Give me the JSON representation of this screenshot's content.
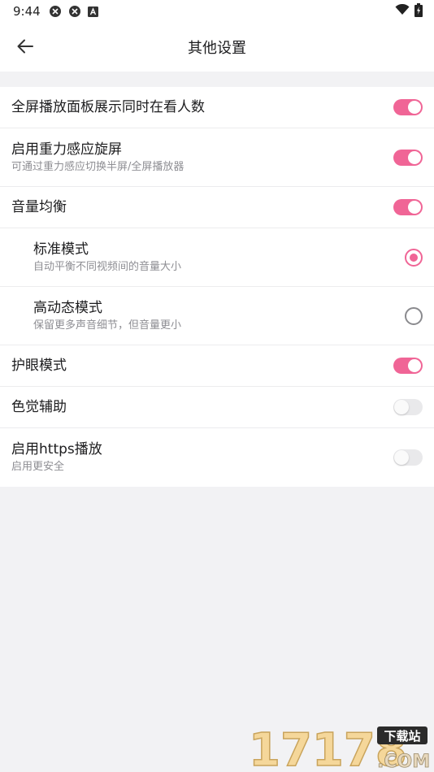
{
  "status_bar": {
    "time": "9:44",
    "icons_left": [
      "sync-icon",
      "sync-icon",
      "a-badge-icon"
    ],
    "icons_right": [
      "wifi-icon",
      "battery-charging-icon"
    ]
  },
  "app_bar": {
    "back_icon": "arrow-left-icon",
    "title": "其他设置"
  },
  "settings": [
    {
      "id": "fullscreen-watch-count",
      "label": "全屏播放面板展示同时在看人数",
      "desc": "",
      "control": "switch",
      "on": true
    },
    {
      "id": "gravity-rotate",
      "label": "启用重力感应旋屏",
      "desc": "可通过重力感应切换半屏/全屏播放器",
      "control": "switch",
      "on": true
    },
    {
      "id": "volume-balance",
      "label": "音量均衡",
      "desc": "",
      "control": "switch",
      "on": true
    },
    {
      "id": "standard-mode",
      "label": "标准模式",
      "desc": "自动平衡不同视频间的音量大小",
      "control": "radio",
      "on": true,
      "sub": true
    },
    {
      "id": "high-dynamic-mode",
      "label": "高动态模式",
      "desc": "保留更多声音细节，但音量更小",
      "control": "radio",
      "on": false,
      "sub": true
    },
    {
      "id": "eye-protection",
      "label": "护眼模式",
      "desc": "",
      "control": "switch",
      "on": true
    },
    {
      "id": "color-assist",
      "label": "色觉辅助",
      "desc": "",
      "control": "switch",
      "on": false
    },
    {
      "id": "https-playback",
      "label": "启用https播放",
      "desc": "启用更安全",
      "control": "switch",
      "on": false
    }
  ],
  "colors": {
    "accent": "#f06596",
    "background": "#f2f2f4",
    "surface": "#ffffff",
    "secondary_text": "#8e8e93"
  },
  "watermark": {
    "logo_text": "17178",
    "badge_text": "下载站",
    "suffix_text": ".COM"
  }
}
